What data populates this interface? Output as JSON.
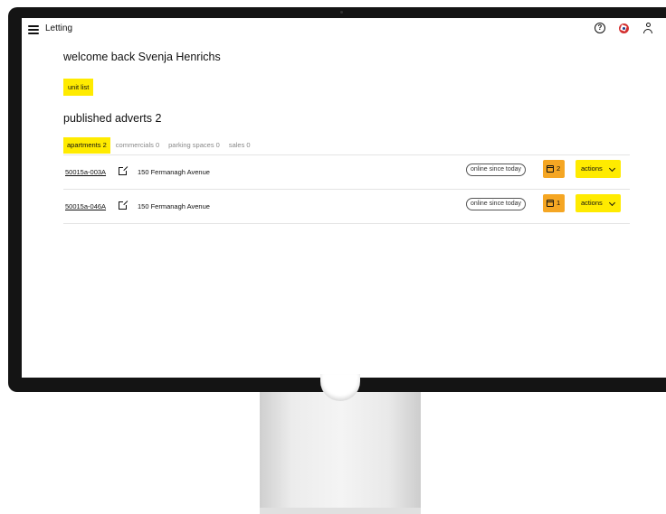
{
  "app": {
    "title": "Letting"
  },
  "header": {
    "icons": [
      "menu-icon",
      "help-icon",
      "flag-icon",
      "user-icon"
    ]
  },
  "welcome": {
    "text": "welcome back Svenja Henrichs"
  },
  "unit_list_button": {
    "label": "unit list"
  },
  "published": {
    "title": "published adverts 2"
  },
  "tabs": [
    {
      "label": "apartments 2",
      "active": true
    },
    {
      "label": "commercials 0",
      "active": false
    },
    {
      "label": "parking spaces 0",
      "active": false
    },
    {
      "label": "sales 0",
      "active": false
    }
  ],
  "adverts": [
    {
      "unit_id": "50015a-003A",
      "address": "150 Fermanagh Avenue",
      "status": "online since today",
      "calendar_count": "2",
      "actions_label": "actions"
    },
    {
      "unit_id": "50015a-046A",
      "address": "150 Fermanagh Avenue",
      "status": "online since today",
      "calendar_count": "1",
      "actions_label": "actions"
    }
  ],
  "colors": {
    "accent_yellow": "#ffeb00",
    "badge_orange": "#f5a623",
    "bezel": "#141414"
  }
}
